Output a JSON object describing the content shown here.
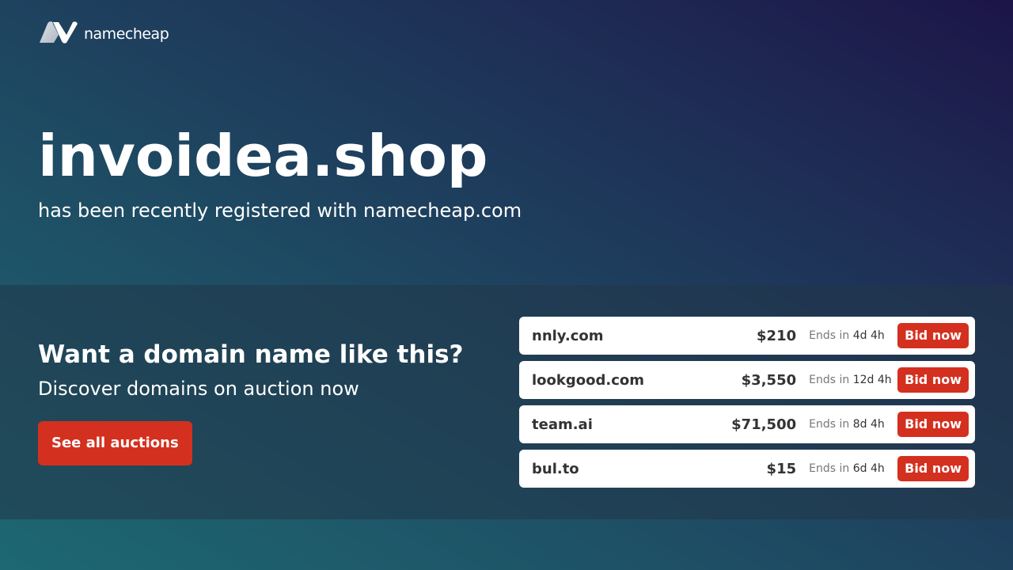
{
  "brand": {
    "name": "namecheap",
    "logo_icon": "namecheap-n-icon"
  },
  "hero": {
    "domain": "invoidea.shop",
    "subtitle": "has been recently registered with namecheap.com"
  },
  "promo": {
    "heading": "Want a domain name like this?",
    "subheading": "Discover domains on auction now",
    "cta_label": "See all auctions"
  },
  "auctions": [
    {
      "name": "nnly.com",
      "price": "$210",
      "ends_label": "Ends in",
      "ends_value": "4d 4h",
      "bid_label": "Bid now"
    },
    {
      "name": "lookgood.com",
      "price": "$3,550",
      "ends_label": "Ends in",
      "ends_value": "12d 4h",
      "bid_label": "Bid now"
    },
    {
      "name": "team.ai",
      "price": "$71,500",
      "ends_label": "Ends in",
      "ends_value": "8d 4h",
      "bid_label": "Bid now"
    },
    {
      "name": "bul.to",
      "price": "$15",
      "ends_label": "Ends in",
      "ends_value": "6d 4h",
      "bid_label": "Bid now"
    }
  ],
  "colors": {
    "accent": "#d4301f",
    "row_bg": "#ffffff",
    "text_dark": "#333333"
  }
}
